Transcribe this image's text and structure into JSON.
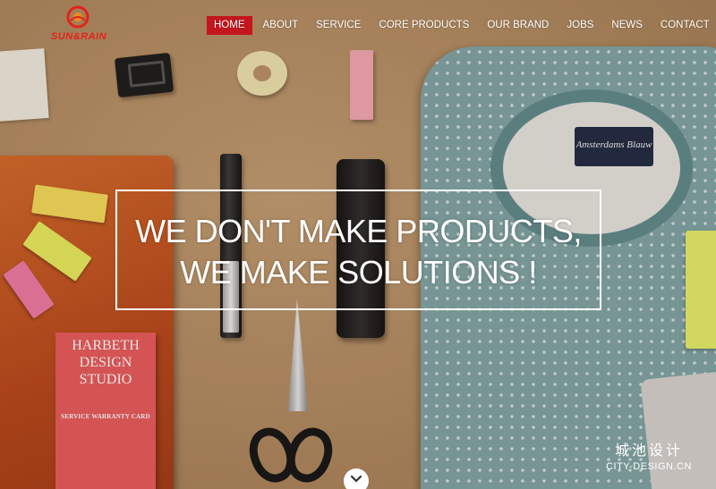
{
  "brand": {
    "logo_text": "SUN&RAIN",
    "accent_color": "#c4161c"
  },
  "nav": {
    "items": [
      {
        "label": "HOME",
        "active": true
      },
      {
        "label": "ABOUT",
        "active": false
      },
      {
        "label": "SERVICE",
        "active": false
      },
      {
        "label": "CORE PRODUCTS",
        "active": false
      },
      {
        "label": "OUR BRAND",
        "active": false
      },
      {
        "label": "JOBS",
        "active": false
      },
      {
        "label": "NEWS",
        "active": false
      },
      {
        "label": "CONTACT",
        "active": false
      }
    ]
  },
  "hero": {
    "line1": "WE DON'T MAKE PRODUCTS,",
    "line2": "WE MAKE SOLUTIONS !",
    "scroll_icon": "chevron-down-icon"
  },
  "photo": {
    "card_title": "HARBETH DESIGN STUDIO",
    "card_subtitle": "SERVICE WARRANTY CARD",
    "label_text": "Amsterdams Blauw"
  },
  "watermark": {
    "cn": "城池设计",
    "en": "CITY-DESIGN.CN"
  }
}
